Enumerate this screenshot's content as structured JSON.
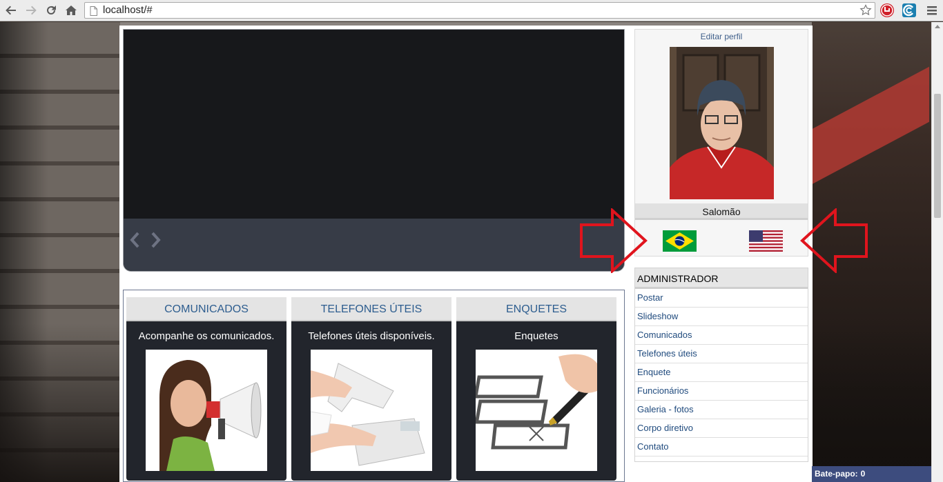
{
  "browser": {
    "url": "localhost/#"
  },
  "slideshow": {
    "prev": "‹",
    "next": "›"
  },
  "boxes": [
    {
      "title": "COMUNICADOS",
      "desc": "Acompanhe os comunicados."
    },
    {
      "title": "TELEFONES ÚTEIS",
      "desc": "Telefones úteis disponíveis."
    },
    {
      "title": "ENQUETES",
      "desc": "Enquetes"
    }
  ],
  "profile": {
    "edit_label": "Editar perfil",
    "name": "Salomão"
  },
  "admin": {
    "header": "ADMINISTRADOR",
    "items": [
      "Postar",
      "Slideshow",
      "Comunicados",
      "Telefones úteis",
      "Enquete",
      "Funcionários",
      "Galeria - fotos",
      "Corpo diretivo",
      "Contato"
    ]
  },
  "chat": {
    "label": "Bate-papo:",
    "count": "0"
  },
  "colors": {
    "accent_link": "#2d5d8f",
    "annotation_red": "#e0141d"
  }
}
